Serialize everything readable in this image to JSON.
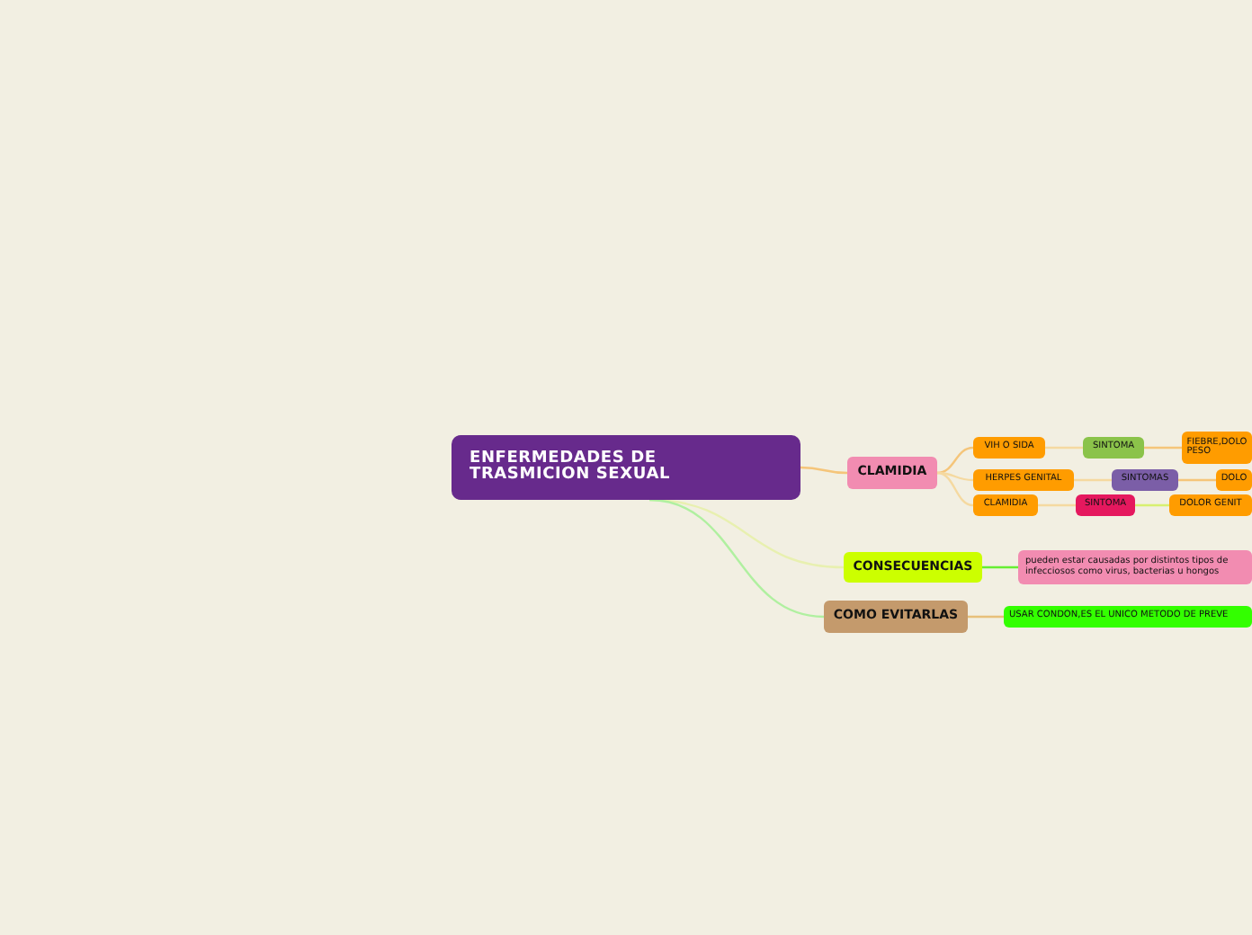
{
  "mind_map": {
    "text": "ENFERMEDADES DE TRASMICION SEXUAL",
    "color": "#672a8c",
    "children": [
      {
        "text": "CLAMIDIA",
        "color": "#f28cb1",
        "children": [
          {
            "text": "VIH O SIDA",
            "color": "#ff9c00",
            "children": [
              {
                "text": "SINTOMA",
                "color": "#8bc34a",
                "children": [
                  {
                    "text": "FIEBRE,DOLO PESO",
                    "color": "#ff9c00"
                  }
                ]
              }
            ]
          },
          {
            "text": "HERPES GENITAL",
            "color": "#ff9c00",
            "children": [
              {
                "text": "SINTOMAS",
                "color": "#7b5ea7",
                "children": [
                  {
                    "text": "DOLO",
                    "color": "#ff9c00"
                  }
                ]
              }
            ]
          },
          {
            "text": "CLAMIDIA",
            "color": "#ff9c00",
            "children": [
              {
                "text": "SINTOMA",
                "color": "#e5185e",
                "children": [
                  {
                    "text": "DOLOR GENIT",
                    "color": "#ff9c00"
                  }
                ]
              }
            ]
          }
        ]
      },
      {
        "text": "CONSECUENCIAS",
        "color": "#ccff00",
        "children": [
          {
            "text": "pueden estar causadas por distintos tipos de infecciosos como virus, bacterias u hongos",
            "color": "#f28cb1"
          }
        ]
      },
      {
        "text": "COMO EVITARLAS",
        "color": "#c49a6c",
        "children": [
          {
            "text": "USAR CONDON,ES EL UNICO METODO DE PREVE",
            "color": "#33ff00"
          }
        ]
      }
    ]
  }
}
